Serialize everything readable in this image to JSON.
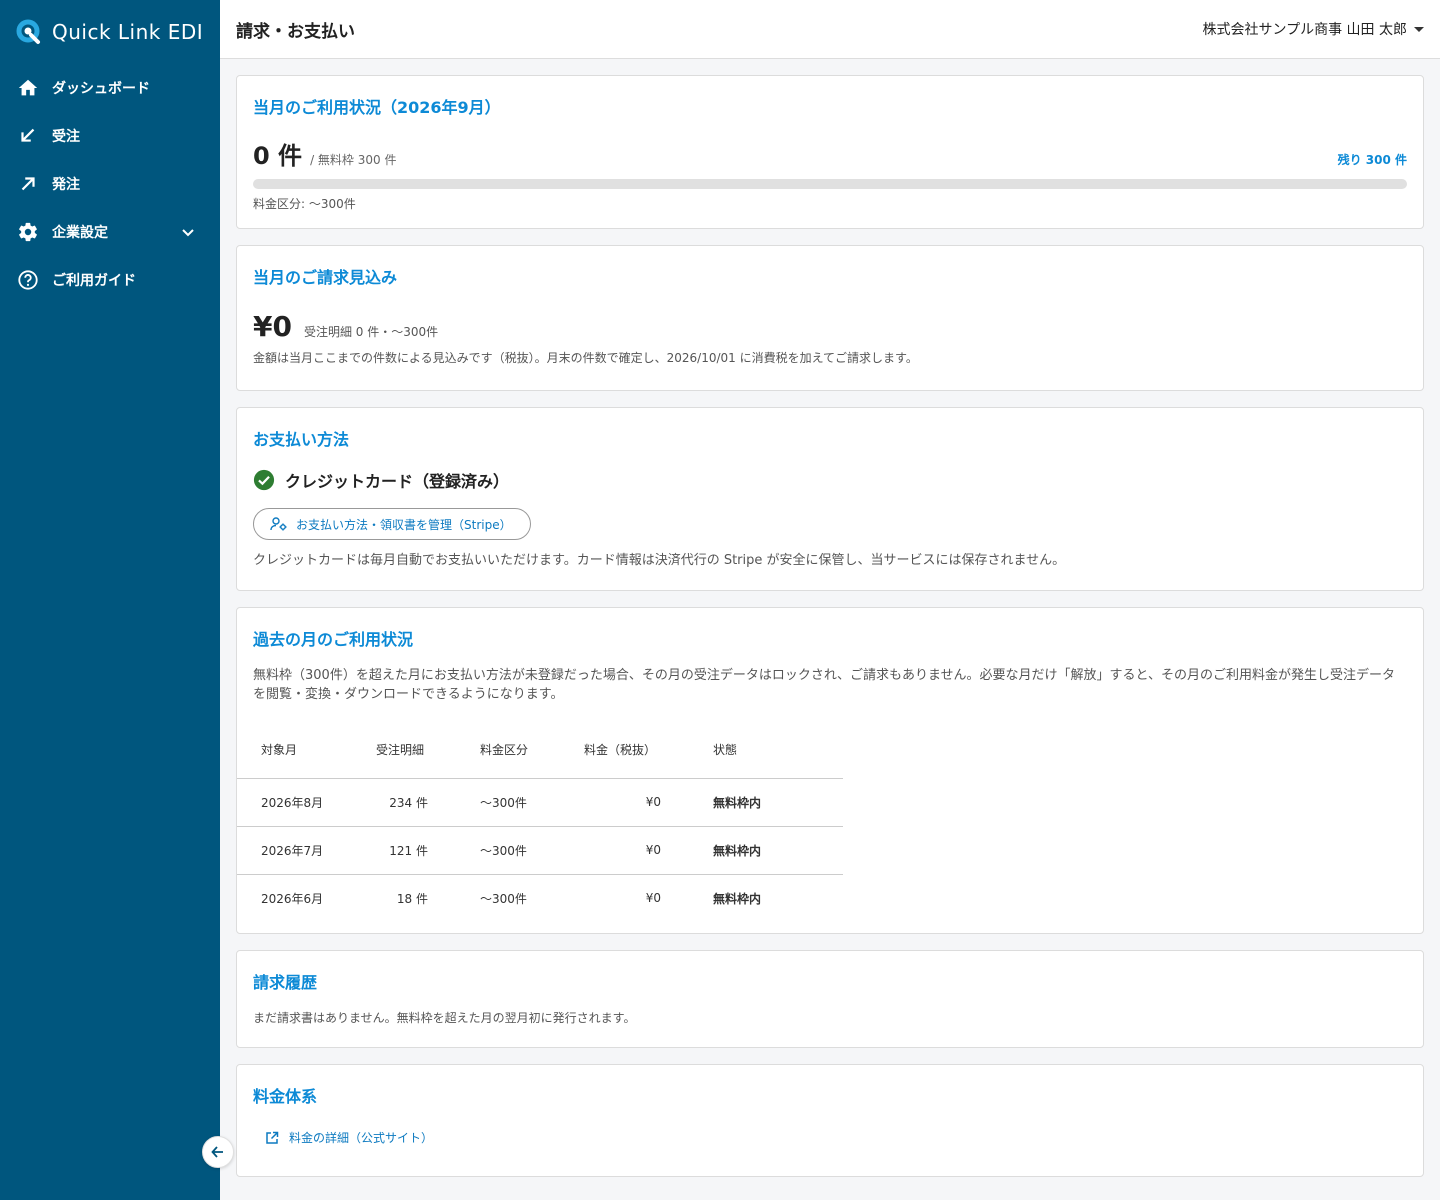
{
  "app": {
    "name": "Quick Link EDI"
  },
  "header": {
    "title": "請求・お支払い",
    "user": "株式会社サンプル商事 山田 太郎"
  },
  "sidebar": {
    "items": [
      {
        "label": "ダッシュボード",
        "icon": "home-icon"
      },
      {
        "label": "受注",
        "icon": "arrow-down-left-icon"
      },
      {
        "label": "発注",
        "icon": "arrow-up-right-icon"
      },
      {
        "label": "企業設定",
        "icon": "gear-icon"
      },
      {
        "label": "ご利用ガイド",
        "icon": "help-icon"
      }
    ]
  },
  "usage": {
    "title": "当月のご利用状況（2026年9月）",
    "count": "0 件",
    "quota": "/ 無料枠 300 件",
    "remaining": "残り 300 件",
    "tier": "料金区分: 〜300件",
    "progress_fraction": 0
  },
  "estimate": {
    "title": "当月のご請求見込み",
    "amount": "¥0",
    "detail": "受注明細 0 件・〜300件",
    "note": "金額は当月ここまでの件数による見込みです（税抜）。月末の件数で確定し、2026/10/01 に消費税を加えてご請求します。"
  },
  "payment": {
    "title": "お支払い方法",
    "status": "クレジットカード（登録済み）",
    "button": "お支払い方法・領収書を管理（Stripe）",
    "note": "クレジットカードは毎月自動でお支払いいただけます。カード情報は決済代行の Stripe が安全に保管し、当サービスには保存されません。"
  },
  "history": {
    "title": "過去の月のご利用状況",
    "description": "無料枠（300件）を超えた月にお支払い方法が未登録だった場合、その月の受注データはロックされ、ご請求もありません。必要な月だけ「解放」すると、その月のご利用料金が発生し受注データを閲覧・変換・ダウンロードできるようになります。",
    "columns": [
      "対象月",
      "受注明細",
      "料金区分",
      "料金（税抜）",
      "状態"
    ],
    "rows": [
      {
        "month": "2026年8月",
        "count": "234 件",
        "tier": "〜300件",
        "fee": "¥0",
        "status": "無料枠内"
      },
      {
        "month": "2026年7月",
        "count": "121 件",
        "tier": "〜300件",
        "fee": "¥0",
        "status": "無料枠内"
      },
      {
        "month": "2026年6月",
        "count": "18 件",
        "tier": "〜300件",
        "fee": "¥0",
        "status": "無料枠内"
      }
    ]
  },
  "invoices": {
    "title": "請求履歴",
    "empty": "まだ請求書はありません。無料枠を超えた月の翌月初に発行されます。"
  },
  "pricing": {
    "title": "料金体系",
    "link": "料金の詳細（公式サイト）"
  },
  "colors": {
    "sidebar": "#00567e",
    "accent": "#0d8ad6",
    "success": "#2e7d32"
  }
}
